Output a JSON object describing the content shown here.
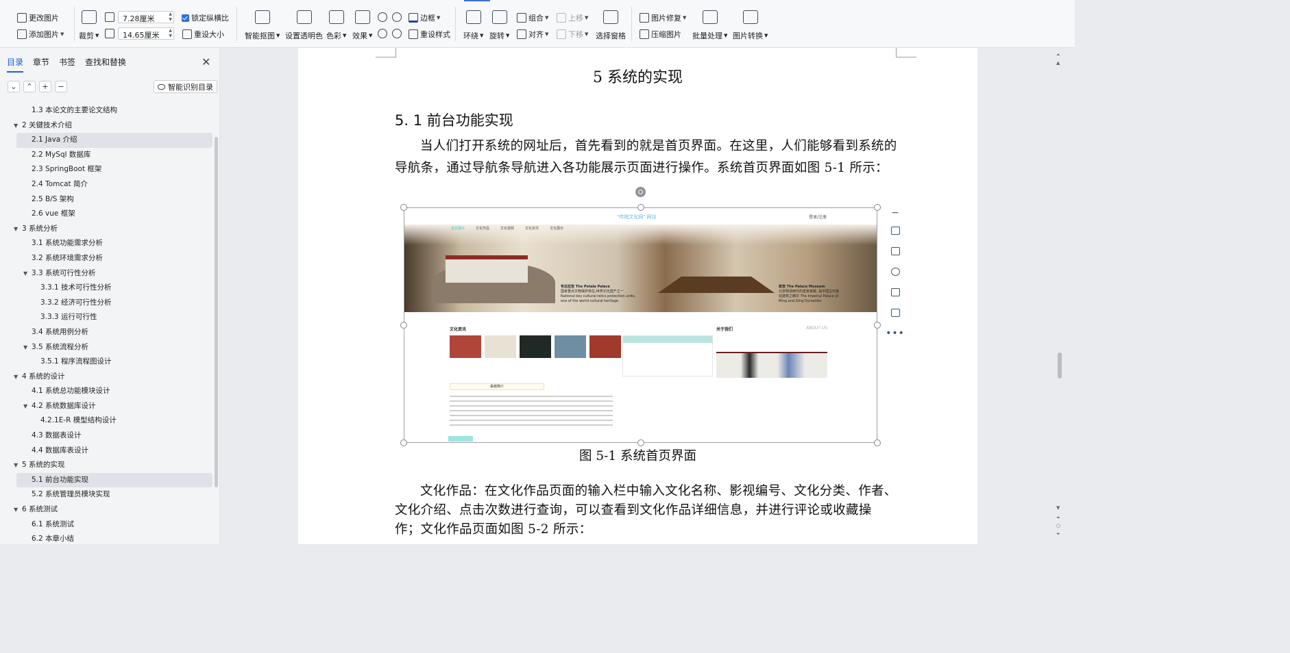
{
  "ribbon": {
    "change_picture": "更改图片",
    "add_picture": "添加图片",
    "crop": "裁剪",
    "width_value": "7.28厘米",
    "height_value": "14.65厘米",
    "lock_ratio": "锁定纵横比",
    "reset_size": "重设大小",
    "smart_matting": "智能抠图",
    "set_transparent": "设置透明色",
    "color": "色彩",
    "effects": "效果",
    "border": "边框",
    "reset_style": "重设样式",
    "wrap": "环绕",
    "rotate": "旋转",
    "group": "组合",
    "align": "对齐",
    "move_up": "上移",
    "move_down": "下移",
    "selection_pane": "选择窗格",
    "picture_repair": "图片修复",
    "compress_picture": "压缩图片",
    "batch_process": "批量处理",
    "picture_convert": "图片转换"
  },
  "nav": {
    "tabs": [
      "目录",
      "章节",
      "书签",
      "查找和替换"
    ],
    "active_tab": 0,
    "smart_toc": "智能识别目录",
    "toc": [
      {
        "label": "1.3  本论文的主要论文结构",
        "level": 2,
        "expand": false,
        "selected": false
      },
      {
        "label": "2   关键技术介绍",
        "level": 1,
        "expand": true,
        "selected": false
      },
      {
        "label": "2.1 Java 介绍",
        "level": 2,
        "expand": false,
        "selected": true
      },
      {
        "label": "2.2 MySql 数据库",
        "level": 2,
        "expand": false,
        "selected": false
      },
      {
        "label": "2.3 SpringBoot 框架",
        "level": 2,
        "expand": false,
        "selected": false
      },
      {
        "label": "2.4 Tomcat 简介",
        "level": 2,
        "expand": false,
        "selected": false
      },
      {
        "label": "2.5 B/S 架构",
        "level": 2,
        "expand": false,
        "selected": false
      },
      {
        "label": "2.6 vue 框架",
        "level": 2,
        "expand": false,
        "selected": false
      },
      {
        "label": "3   系统分析",
        "level": 1,
        "expand": true,
        "selected": false
      },
      {
        "label": "3.1 系统功能需求分析",
        "level": 2,
        "expand": false,
        "selected": false
      },
      {
        "label": "3.2  系统环境需求分析",
        "level": 2,
        "expand": false,
        "selected": false
      },
      {
        "label": "3.3   系统可行性分析",
        "level": 2,
        "expand": true,
        "selected": false
      },
      {
        "label": "3.3.1   技术可行性分析",
        "level": 3,
        "expand": false,
        "selected": false
      },
      {
        "label": "3.3.2   经济可行性分析",
        "level": 3,
        "expand": false,
        "selected": false
      },
      {
        "label": "3.3.3   运行可行性",
        "level": 3,
        "expand": false,
        "selected": false
      },
      {
        "label": "3.4  系统用例分析",
        "level": 2,
        "expand": false,
        "selected": false
      },
      {
        "label": "3.5 系统流程分析",
        "level": 2,
        "expand": true,
        "selected": false
      },
      {
        "label": "3.5.1 程序流程图设计",
        "level": 3,
        "expand": false,
        "selected": false
      },
      {
        "label": "4   系统的设计",
        "level": 1,
        "expand": true,
        "selected": false
      },
      {
        "label": "4.1  系统总功能模块设计",
        "level": 2,
        "expand": false,
        "selected": false
      },
      {
        "label": "4.2  系统数据库设计",
        "level": 2,
        "expand": true,
        "selected": false
      },
      {
        "label": "4.2.1E-R 模型结构设计",
        "level": 3,
        "expand": false,
        "selected": false
      },
      {
        "label": "4.3 数据表设计",
        "level": 2,
        "expand": false,
        "selected": false
      },
      {
        "label": "4.4 数据库表设计",
        "level": 2,
        "expand": false,
        "selected": false
      },
      {
        "label": "5   系统的实现",
        "level": 1,
        "expand": true,
        "selected": false
      },
      {
        "label": "5.1 前台功能实现",
        "level": 2,
        "expand": false,
        "selected": true
      },
      {
        "label": "5.2 系统管理员模块实现",
        "level": 2,
        "expand": false,
        "selected": false
      },
      {
        "label": "6 系统测试",
        "level": 1,
        "expand": true,
        "selected": false
      },
      {
        "label": "6.1 系统测试",
        "level": 2,
        "expand": false,
        "selected": false
      },
      {
        "label": "6.2 本章小结",
        "level": 2,
        "expand": false,
        "selected": false
      }
    ]
  },
  "doc": {
    "chapter_title": "5   系统的实现",
    "section_title": "5. 1 前台功能实现",
    "para1": "当人们打开系统的网址后，首先看到的就是首页界面。在这里，人们能够看到系统的导航条，通过导航条导航进入各功能展示页面进行操作。系统首页界面如图 5-1 所示：",
    "caption": "图 5-1  系统首页界面",
    "para2": "文化作品：在文化作品页面的输入栏中输入文化名称、影视编号、文化分类、作者、文化介绍、点击次数进行查询，可以查看到文化作品详细信息，并进行评论或收藏操作；文化作品页面如图 5-2 所示："
  },
  "figure": {
    "site_title": "\"传统文化网\" 网站",
    "login": "登录/注册",
    "nav": [
      "首页展示",
      "文化作品",
      "文化视频",
      "文化资讯",
      "文化展示"
    ],
    "banner_left_title": "布达拉宫 The Potala Palace",
    "banner_left_sub": "国家重点文物保护单位,世界文化遗产之一 National key cultural relics protection units, one of the world cultural heritage.",
    "banner_right_title": "故宫 The Palace Museum",
    "banner_right_sub": "北京明清两代的皇家宫殿, 是中国古代宫廷建筑之精华 The Imperial Palace of Ming and Qing Dynasties",
    "news_title": "文化资讯",
    "about_title": "关于我们",
    "about_en": "ABOUT US",
    "intro_title": "系统简介"
  },
  "colors": {
    "accent": "#1e5fd6",
    "selection_bg": "#dfe2e6"
  }
}
